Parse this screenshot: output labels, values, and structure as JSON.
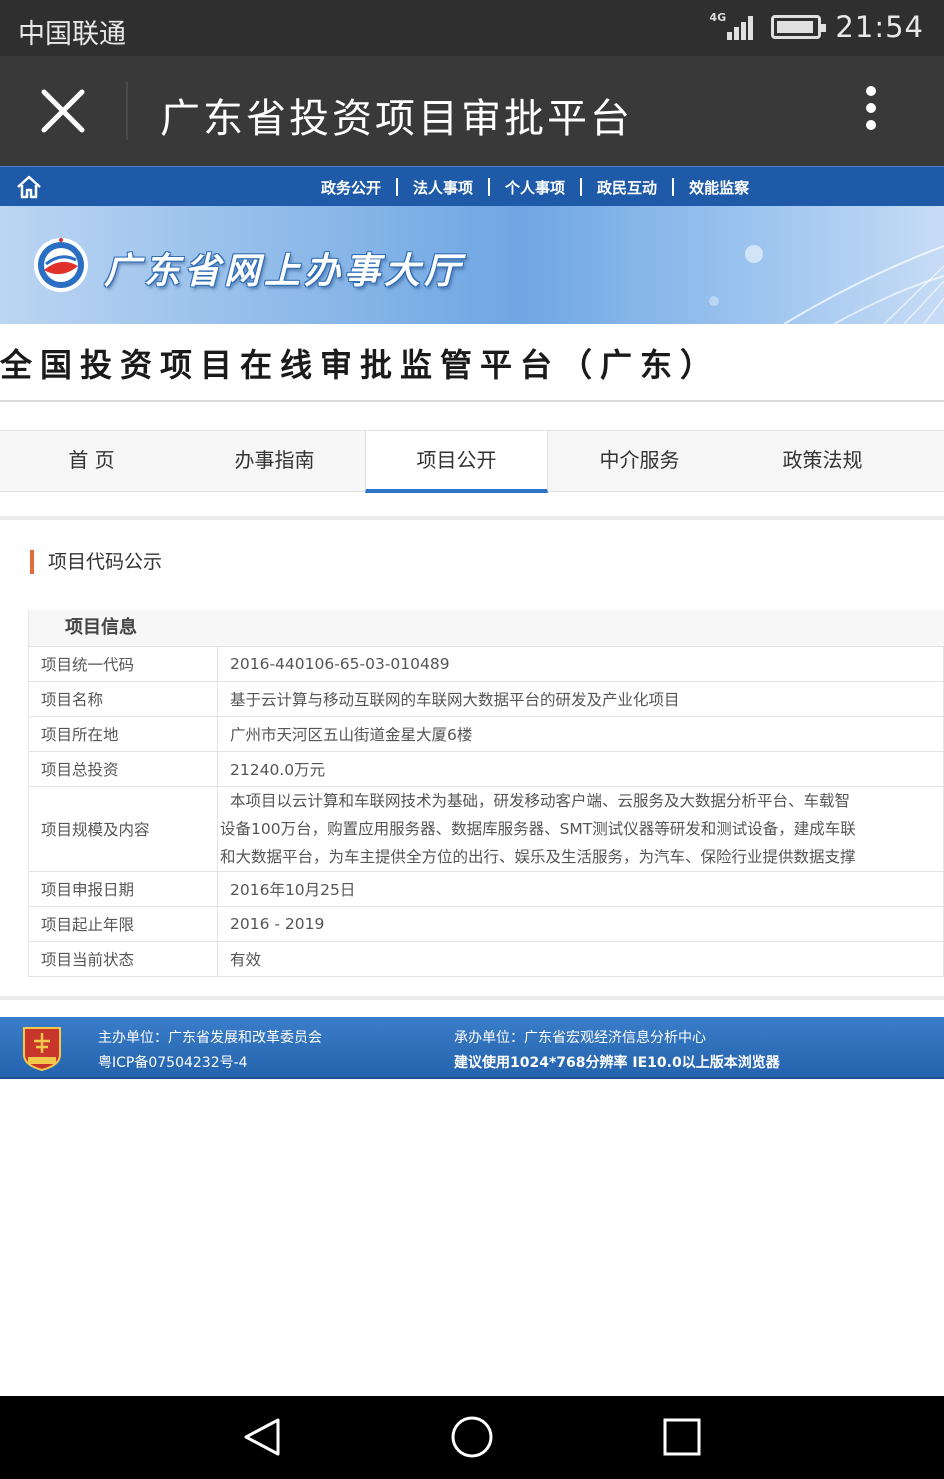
{
  "status_bar": {
    "carrier": "中国联通",
    "network": "4G",
    "time": "21:54"
  },
  "app_bar": {
    "title": "广东省投资项目审批平台",
    "close_icon": "close-icon",
    "more_icon": "more-vertical-icon"
  },
  "top_nav": {
    "home_icon": "home-icon",
    "links": [
      "政务公开",
      "法人事项",
      "个人事项",
      "政民互动",
      "效能监察"
    ]
  },
  "banner": {
    "title": "广东省网上办事大厅"
  },
  "platform_title": "全国投资项目在线审批监管平台（广东）",
  "tabs": [
    {
      "label": "首 页",
      "active": false
    },
    {
      "label": "办事指南",
      "active": false
    },
    {
      "label": "项目公开",
      "active": true
    },
    {
      "label": "中介服务",
      "active": false
    },
    {
      "label": "政策法规",
      "active": false
    }
  ],
  "section": {
    "title": "项目代码公示",
    "table_header": "项目信息",
    "rows": [
      {
        "key": "项目统一代码",
        "value": "2016-440106-65-03-010489"
      },
      {
        "key": "项目名称",
        "value": "基于云计算与移动互联网的车联网大数据平台的研发及产业化项目"
      },
      {
        "key": "项目所在地",
        "value": "广州市天河区五山街道金星大厦6楼"
      },
      {
        "key": "项目总投资",
        "value": "21240.0万元"
      },
      {
        "key": "项目规模及内容",
        "value_lines": [
          "本项目以云计算和车联网技术为基础，研发移动客户端、云服务及大数据分析平台、车载智",
          "设备100万台，购置应用服务器、数据库服务器、SMT测试仪器等研发和测试设备，建成车联",
          "和大数据平台，为车主提供全方位的出行、娱乐及生活服务，为汽车、保险行业提供数据支撑"
        ]
      },
      {
        "key": "项目申报日期",
        "value": "2016年10月25日"
      },
      {
        "key": "项目起止年限",
        "value": "2016 - 2019"
      },
      {
        "key": "项目当前状态",
        "value": "有效"
      }
    ]
  },
  "footer": {
    "sponsor": "主办单位：广东省发展和改革委员会",
    "icp": "粤ICP备07504232号-4",
    "organizer": "承办单位：广东省宏观经济信息分析中心",
    "browser_tip": "建议使用1024*768分辨率 IE10.0以上版本浏览器",
    "logo_text": "党政机关"
  },
  "nav_bar": {
    "back_icon": "back-triangle-icon",
    "home_icon": "home-circle-icon",
    "recents_icon": "recents-square-icon"
  },
  "colors": {
    "status_bar": "#2f2f2f",
    "app_bar": "#393939",
    "top_nav": "#1e5aa8",
    "tab_active_underline": "#2b75c8",
    "section_marker": "#e36b3a",
    "footer": "#2563ad"
  }
}
